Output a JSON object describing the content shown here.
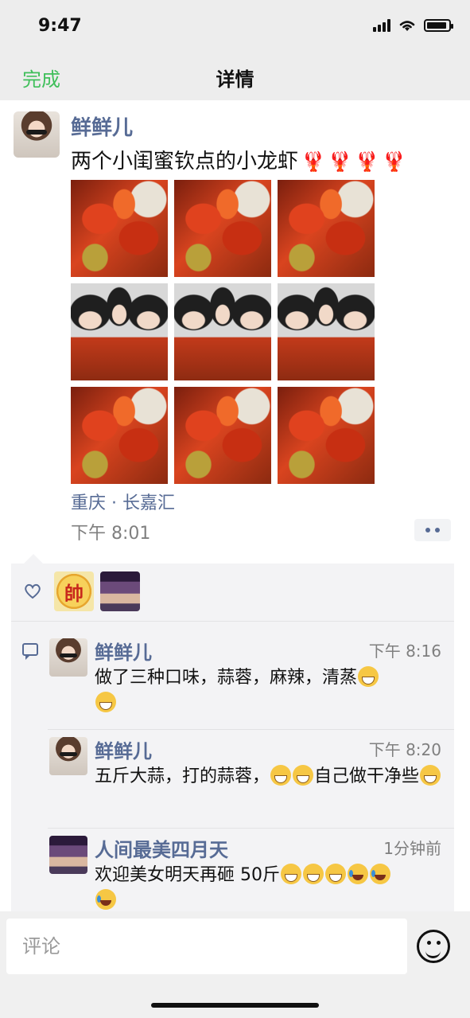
{
  "status_bar": {
    "time": "9:47"
  },
  "nav": {
    "done_label": "完成",
    "title": "详情"
  },
  "post": {
    "author": "鲜鲜儿",
    "text": "两个小闺蜜钦点的小龙虾",
    "text_emojis": [
      "lobster",
      "lobster",
      "lobster",
      "lobster"
    ],
    "photos": [
      "crayfish",
      "crayfish",
      "crayfish",
      "selfie",
      "selfie",
      "selfie",
      "crayfish",
      "crayfish",
      "crayfish"
    ],
    "location": "重庆 · 长嘉汇",
    "time": "下午 8:01"
  },
  "likes": {
    "avatars": [
      {
        "name": "帥"
      },
      {
        "name": "poster"
      }
    ]
  },
  "comments": [
    {
      "author": "鲜鲜儿",
      "time": "下午 8:16",
      "text_before": "做了三种口味，蒜蓉，麻辣，清蒸",
      "emojis_after": [
        "grin",
        "grin"
      ]
    },
    {
      "author": "鲜鲜儿",
      "time": "下午 8:20",
      "text_before": "五斤大蒜，打的蒜蓉，",
      "emojis_mid": [
        "grin",
        "grin"
      ],
      "text_after": "自己做干净些",
      "emojis_after": [
        "grin"
      ]
    },
    {
      "author": "人间最美四月天",
      "time": "1分钟前",
      "text_before": "欢迎美女明天再砸 50斤",
      "emojis_after": [
        "grin",
        "grin",
        "grin",
        "laugh",
        "laugh",
        "laugh"
      ]
    }
  ],
  "input": {
    "placeholder": "评论"
  },
  "colors": {
    "accent_green": "#3fbf5a",
    "name_blue": "#576b95",
    "lobster_red": "#d7331b"
  }
}
